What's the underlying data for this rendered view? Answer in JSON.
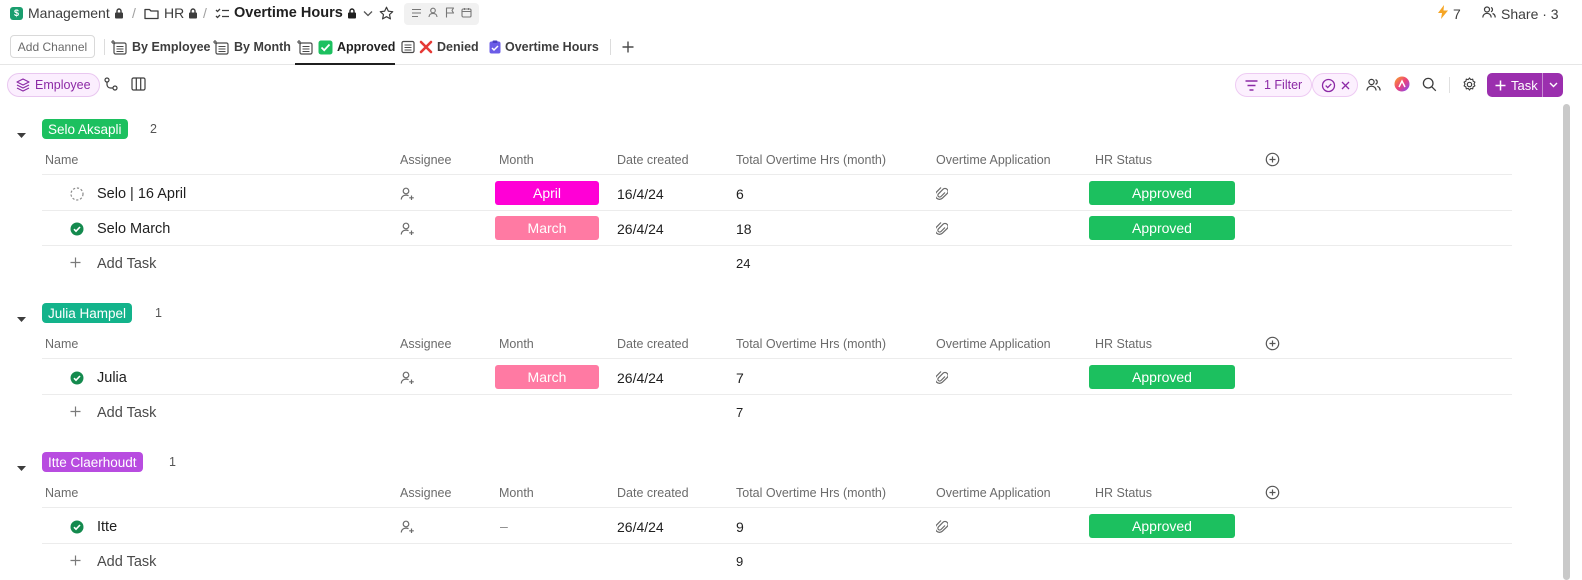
{
  "breadcrumb": {
    "workspace_badge": "$",
    "workspace": "Management",
    "folder": "HR",
    "list": "Overtime Hours",
    "separator": "/"
  },
  "top_right": {
    "automations_count": "7",
    "share_label": "Share · 3"
  },
  "tabs": {
    "add_channel": "Add Channel",
    "items": [
      {
        "label": "By Employee"
      },
      {
        "label": "By Month"
      },
      {
        "label": "Approved"
      },
      {
        "label": "Denied"
      },
      {
        "label": "Overtime Hours"
      }
    ]
  },
  "toolbar": {
    "group_by": "Employee",
    "filter": "1 Filter",
    "task_button": "Task"
  },
  "columns": [
    "Name",
    "Assignee",
    "Month",
    "Date created",
    "Total Overtime Hrs (month)",
    "Overtime Application",
    "HR Status"
  ],
  "colors": {
    "accent": "#9b2fae",
    "approved": "#1cc05f",
    "month_april": "#ff00d6",
    "month_march": "#ff7aa3",
    "group_selo": "#1cc05f",
    "group_julia": "#13b38b",
    "group_itte": "#b84ce0"
  },
  "groups": [
    {
      "name": "Selo Aksapli",
      "count": "2",
      "add_task": "Add Task",
      "total": "24",
      "rows": [
        {
          "name": "Selo | 16 April",
          "month": "April",
          "date": "16/4/24",
          "hours": "6",
          "hr_status": "Approved",
          "status": "open"
        },
        {
          "name": "Selo March",
          "month": "March",
          "date": "26/4/24",
          "hours": "18",
          "hr_status": "Approved",
          "status": "done"
        }
      ]
    },
    {
      "name": "Julia Hampel",
      "count": "1",
      "add_task": "Add Task",
      "total": "7",
      "rows": [
        {
          "name": "Julia",
          "month": "March",
          "date": "26/4/24",
          "hours": "7",
          "hr_status": "Approved",
          "status": "done"
        }
      ]
    },
    {
      "name": "Itte Claerhoudt",
      "count": "1",
      "add_task": "Add Task",
      "total": "9",
      "rows": [
        {
          "name": "Itte",
          "month": "–",
          "date": "26/4/24",
          "hours": "9",
          "hr_status": "Approved",
          "status": "done"
        }
      ]
    }
  ]
}
